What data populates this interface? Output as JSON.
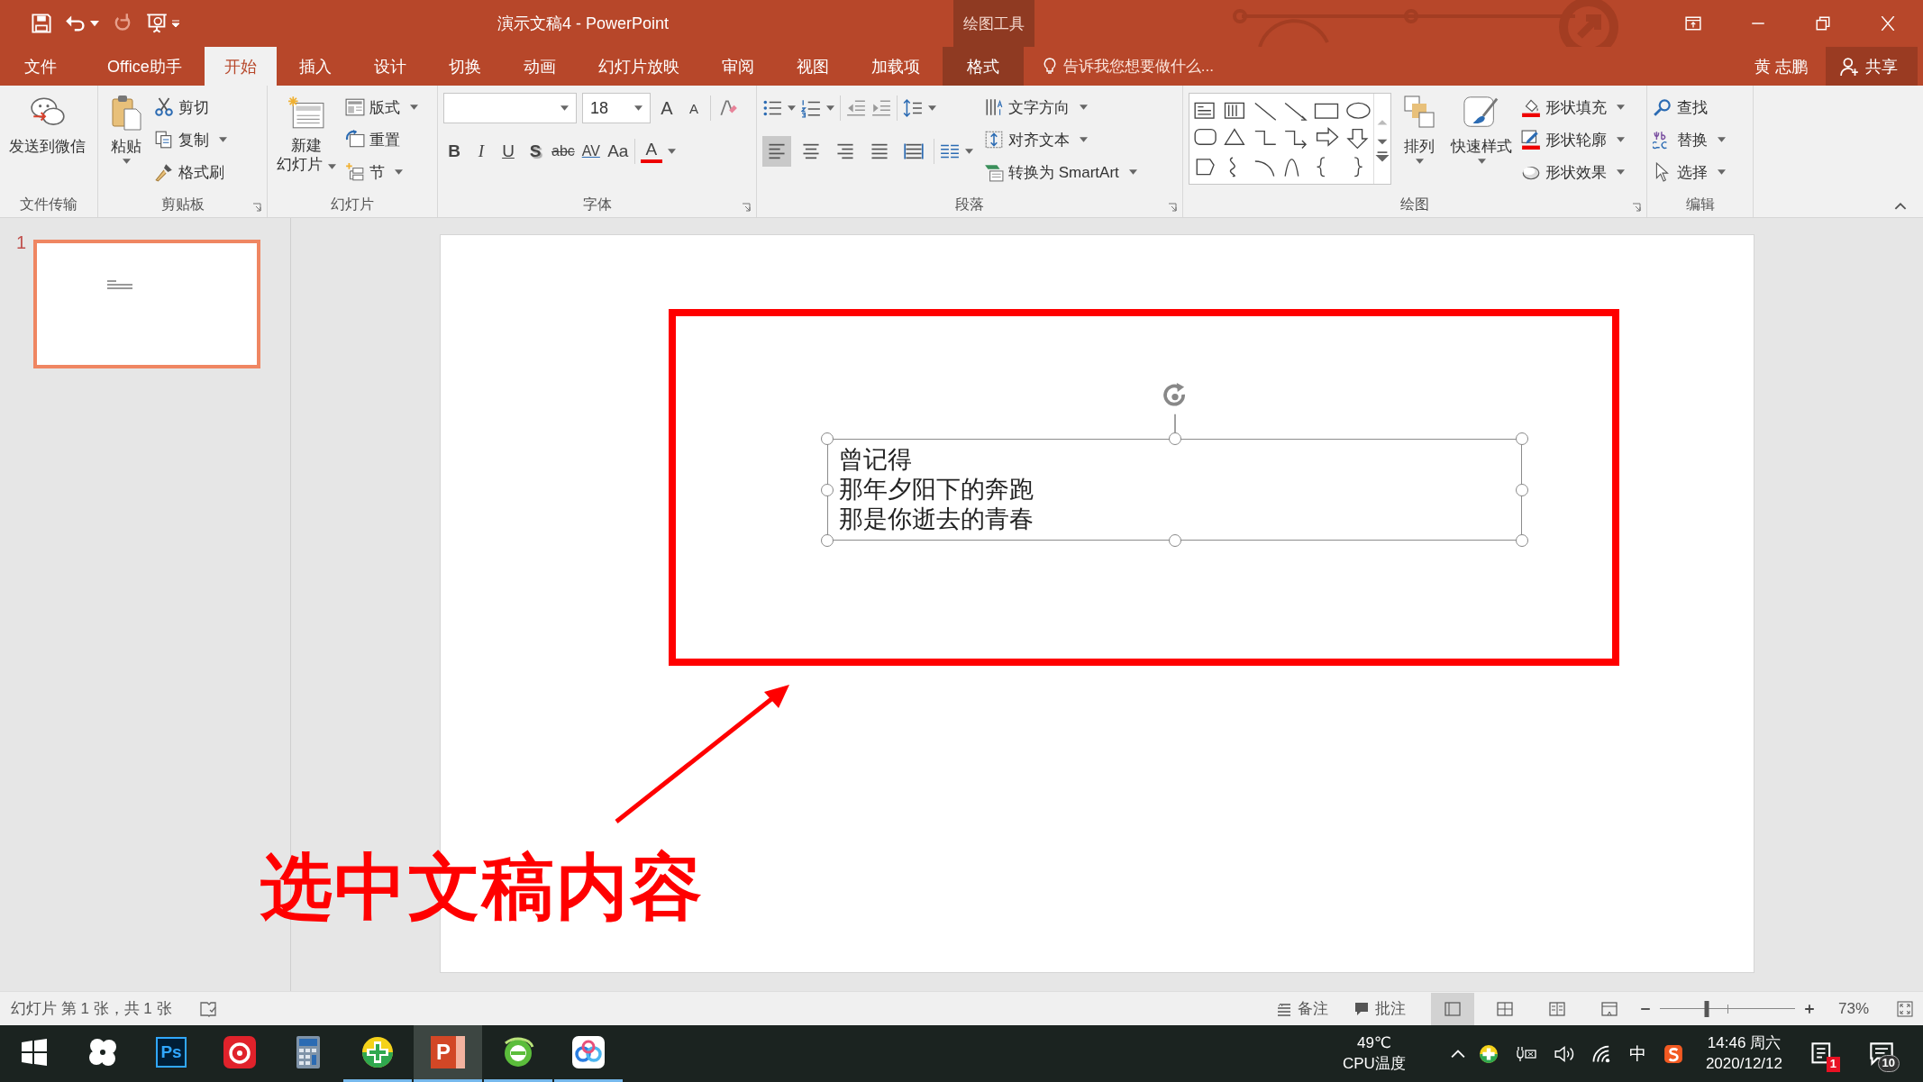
{
  "window": {
    "title": "演示文稿4 - PowerPoint",
    "context_group": "绘图工具"
  },
  "tabs": [
    {
      "label": "文件",
      "selected": false,
      "kind": "normal"
    },
    {
      "label": "Office助手",
      "selected": false,
      "kind": "normal"
    },
    {
      "label": "开始",
      "selected": true,
      "kind": "normal"
    },
    {
      "label": "插入",
      "selected": false,
      "kind": "normal"
    },
    {
      "label": "设计",
      "selected": false,
      "kind": "normal"
    },
    {
      "label": "切换",
      "selected": false,
      "kind": "normal"
    },
    {
      "label": "动画",
      "selected": false,
      "kind": "normal"
    },
    {
      "label": "幻灯片放映",
      "selected": false,
      "kind": "normal"
    },
    {
      "label": "审阅",
      "selected": false,
      "kind": "normal"
    },
    {
      "label": "视图",
      "selected": false,
      "kind": "normal"
    },
    {
      "label": "加载项",
      "selected": false,
      "kind": "normal"
    },
    {
      "label": "格式",
      "selected": false,
      "kind": "contextual"
    }
  ],
  "tell_me": {
    "placeholder": "告诉我您想要做什么..."
  },
  "user": {
    "name": "黄 志鹏"
  },
  "share": {
    "label": "共享"
  },
  "ribbon": {
    "file_transfer": {
      "label": "文件传输",
      "send": "发送到微信"
    },
    "clipboard": {
      "label": "剪贴板",
      "paste": "粘贴",
      "cut": "剪切",
      "copy": "复制",
      "format_painter": "格式刷"
    },
    "slides": {
      "label": "幻灯片",
      "new_slide": [
        "新建",
        "幻灯片"
      ],
      "layout": "版式",
      "reset": "重置",
      "section": "节"
    },
    "font": {
      "label": "字体",
      "font_size": "18",
      "grow": "A",
      "shrink": "A",
      "formats": [
        "B",
        "I",
        "U",
        "S",
        "abc",
        "AV",
        "Aa"
      ],
      "font_color": "A"
    },
    "paragraph": {
      "label": "段落",
      "alignment": [
        {
          "selected": true
        },
        {
          "selected": false
        },
        {
          "selected": false
        },
        {
          "selected": false
        },
        {
          "selected": false
        }
      ],
      "text_direction": "文字方向",
      "align_text": "对齐文本",
      "smartart": "转换为 SmartArt"
    },
    "drawing": {
      "label": "绘图",
      "arrange": "排列",
      "quick_styles": "快速样式",
      "fill": "形状填充",
      "outline": "形状轮廓",
      "effects": "形状效果"
    },
    "editing": {
      "label": "编辑",
      "find": "查找",
      "replace": "替换",
      "select": "选择"
    }
  },
  "thumbnails": [
    {
      "number": "1",
      "selected": true
    }
  ],
  "slide": {
    "text_box": {
      "selected": true,
      "lines": [
        "曾记得",
        "那年夕阳下的奔跑",
        "那是你逝去的青春"
      ]
    }
  },
  "annotation": {
    "caption": "选中文稿内容"
  },
  "status_bar": {
    "slide_info": "幻灯片 第 1 张，共 1 张",
    "notes": "备注",
    "comments": "批注",
    "views": [
      {
        "selected": true
      },
      {
        "selected": false
      },
      {
        "selected": false
      },
      {
        "selected": false
      }
    ],
    "zoom_slider": {
      "level": 0.35
    },
    "zoom": "73%"
  },
  "taskbar": {
    "apps": [
      {
        "kind": "start",
        "running": false,
        "active": false
      },
      {
        "kind": "pinwheel",
        "running": false,
        "active": false
      },
      {
        "kind": "photoshop",
        "label": "Ps",
        "running": false,
        "active": false
      },
      {
        "kind": "music",
        "running": false,
        "active": false
      },
      {
        "kind": "calculator",
        "running": false,
        "active": false
      },
      {
        "kind": "guard",
        "running": true,
        "active": false
      },
      {
        "kind": "powerpoint",
        "label": "P",
        "running": true,
        "active": true
      },
      {
        "kind": "browser",
        "running": true,
        "active": false
      },
      {
        "kind": "cloud",
        "running": true,
        "active": false
      }
    ],
    "temperature": "49℃",
    "temperature_label": "CPU温度",
    "ime": "中",
    "time": "14:46 周六",
    "date": "2020/12/12",
    "notifications": "1",
    "action_center": "10"
  }
}
